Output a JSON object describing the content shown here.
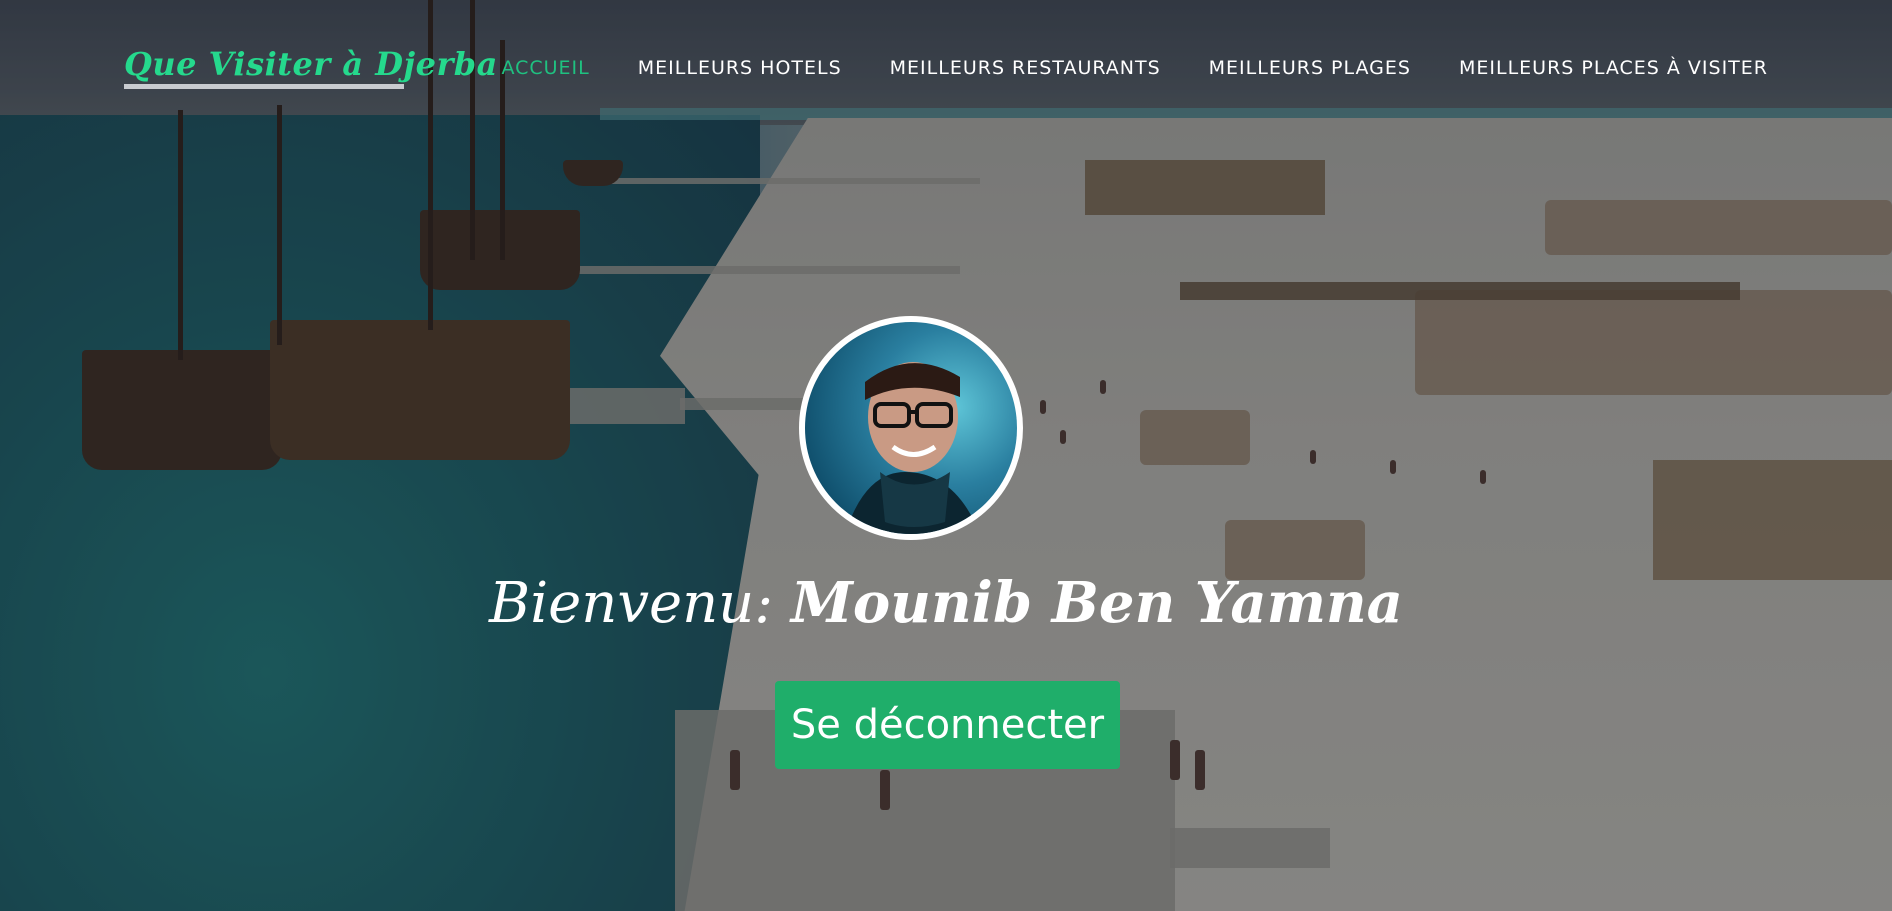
{
  "nav": {
    "brand": "Que Visiter à Djerba",
    "items": [
      {
        "label": "ACCUEIL",
        "active": true
      },
      {
        "label": "MEILLEURS HOTELS",
        "active": false
      },
      {
        "label": "MEILLEURS RESTAURANTS",
        "active": false
      },
      {
        "label": "MEILLEURS PLAGES",
        "active": false
      },
      {
        "label": "MEILLEURS PLACES À VISITER",
        "active": false
      }
    ]
  },
  "hero": {
    "greeting": "Bienvenu:",
    "user_name": "Mounib Ben Yamna",
    "logout_label": "Se déconnecter"
  },
  "colors": {
    "accent": "#1fc180",
    "button": "#1fae6a",
    "brand": "#25d98d"
  }
}
